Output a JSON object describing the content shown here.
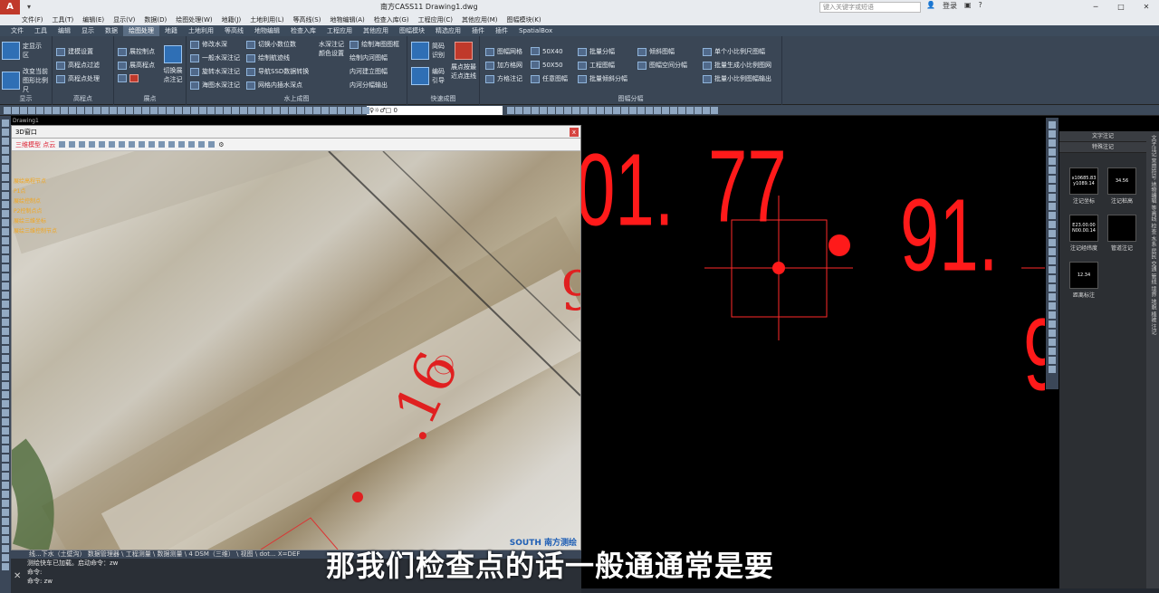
{
  "titlebar": {
    "title": "南方CASS11    Drawing1.dwg",
    "search_placeholder": "键入关键字或短语",
    "login": "登录",
    "win_min": "─",
    "win_max": "□",
    "win_close": "✕"
  },
  "menu": [
    "文件(F)",
    "工具(T)",
    "编辑(E)",
    "显示(V)",
    "数据(D)",
    "绘图处理(W)",
    "地籍(J)",
    "土地利用(L)",
    "等高线(S)",
    "地物编辑(A)",
    "检查入库(G)",
    "工程应用(C)",
    "其他应用(M)",
    "图幅模块(K)"
  ],
  "ribbon_tabs": [
    "文件",
    "工具",
    "编辑",
    "显示",
    "数据",
    "绘图处理",
    "地籍",
    "土地利用",
    "等高线",
    "地物编辑",
    "检查入库",
    "工程应用",
    "其他应用",
    "图幅模块",
    "精选应用",
    "插件",
    "插件",
    "SpatialBox"
  ],
  "ribbon_active": "绘图处理",
  "ribbon": {
    "panels": {
      "display": "显示",
      "elevation": "高程点",
      "points": "展点",
      "water": "水上成图",
      "fast": "快速成图",
      "sheet": "图幅分幅"
    },
    "buttons": {
      "change_area": "改变当前图形比例尺",
      "cont_zone": "定显示区",
      "build_settings": "建模设置",
      "elev_filter": "高程点过滤",
      "elev_process": "高程点处理",
      "show_control": "展控制点",
      "show_elev": "展高程点",
      "switch_display": "切换展点注记",
      "mod_depth": "修改水深",
      "one_depth": "一般水深注记",
      "rotate_depth": "旋转水深注记",
      "sea_depth": "海图水深注记",
      "switch_decimal": "切换小数位数",
      "draw_contour": "绘制航迹线",
      "ssd_convert": "导航SSD数据转换",
      "grid_depth": "网格内插水深点",
      "water_annot": "水深注记颜色设置",
      "draw_sea_frame": "绘制海图图框",
      "draw_inner": "绘制内河图幅",
      "inner_build": "内河建立图幅",
      "inner_split": "内河分幅输出",
      "simple_id": "简码识别",
      "build_code": "编码引导",
      "show_gis": "展点按最近点连线",
      "sheet_grid": "图幅网格",
      "add_grid": "加方格网",
      "square_note": "方格注记",
      "s5040": "50X40",
      "s5050": "50X50",
      "any_frame": "任意图幅",
      "batch_split": "批量分幅",
      "eng_frame": "工程图幅",
      "batch_tilt": "批量倾斜分幅",
      "tilt_frame": "倾斜图幅",
      "frame_space": "图幅空间分幅",
      "single_scale": "单个小比例尺图幅",
      "batch_small": "批量生成小比例图网",
      "batch_out": "批量小比例图幅输出"
    }
  },
  "layer_field": "♀☼♂□ 0",
  "drawing_tab": "Drawing1",
  "win3d": {
    "title": "3D窗口",
    "close": "x",
    "toolbar_label": "三维模型 点云",
    "layers": [
      "展绘高程节点",
      "P1点",
      "展绘控制点",
      "P2控制点点",
      "展绘三维坐标",
      "展绘三维控制节点"
    ],
    "watermark": "SOUTH 南方测绘",
    "photo_label": ".16"
  },
  "cad_numbers": [
    "01.",
    "77",
    "91.",
    "9"
  ],
  "palette": {
    "tab1": "文字注记",
    "tab2": "特殊注记",
    "items": [
      {
        "label": "注记坐标",
        "preview1": "x10685.83",
        "preview2": "y1089.14"
      },
      {
        "label": "注记桩高",
        "preview1": "34.56",
        "preview2": ""
      },
      {
        "label": "注记经纬度",
        "preview1": "E23.00.00",
        "preview2": "N00.00.14"
      },
      {
        "label": "管道注记",
        "preview1": "",
        "preview2": ""
      },
      {
        "label": "距离标注",
        "preview1": "12.34",
        "preview2": ""
      }
    ]
  },
  "vtabs": "文字注记 常用符号 地物编辑 等高线 检查 水系 居民 交通 管线 境界 地貌 植被 注记",
  "status_line": "线...下水（土壁沟） 数据管理器 \\ 工程测量 \\ 数据测量 \\ 4 DSM（三维） \\ 视图 \\ dot... X=DEF",
  "cmd": {
    "line1": "测绘快车已加载。启动命令：zw",
    "line2": "命令:",
    "line3": "命令: zw",
    "close_icon": "✕"
  },
  "subtitle": "那我们检查点的话一般通通常是要"
}
